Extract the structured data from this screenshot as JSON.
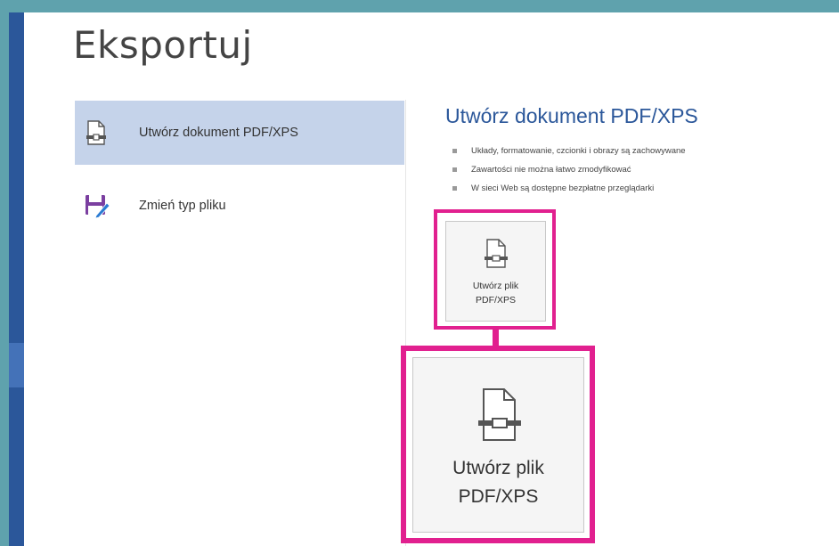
{
  "page": {
    "title": "Eksportuj"
  },
  "nav": {
    "items": [
      {
        "label": "Utwórz dokument PDF/XPS",
        "icon": "pdf-document-icon",
        "active": true
      },
      {
        "label": "Zmień typ pliku",
        "icon": "save-as-icon",
        "active": false
      }
    ]
  },
  "detail": {
    "title": "Utwórz dokument PDF/XPS",
    "bullets": [
      "Układy, formatowanie, czcionki i obrazy są zachowywane",
      "Zawartości nie można łatwo zmodyfikować",
      "W sieci Web są dostępne bezpłatne przeglądarki"
    ],
    "button": {
      "line1": "Utwórz plik",
      "line2": "PDF/XPS",
      "icon": "pdf-document-icon"
    },
    "zoomed_button": {
      "line1": "Utwórz plik",
      "line2": "PDF/XPS",
      "icon": "pdf-document-icon"
    }
  },
  "colors": {
    "accent": "#2b579a",
    "highlight": "#e1208f",
    "active_nav": "#c5d3ea",
    "background": "#5fa2ad"
  }
}
